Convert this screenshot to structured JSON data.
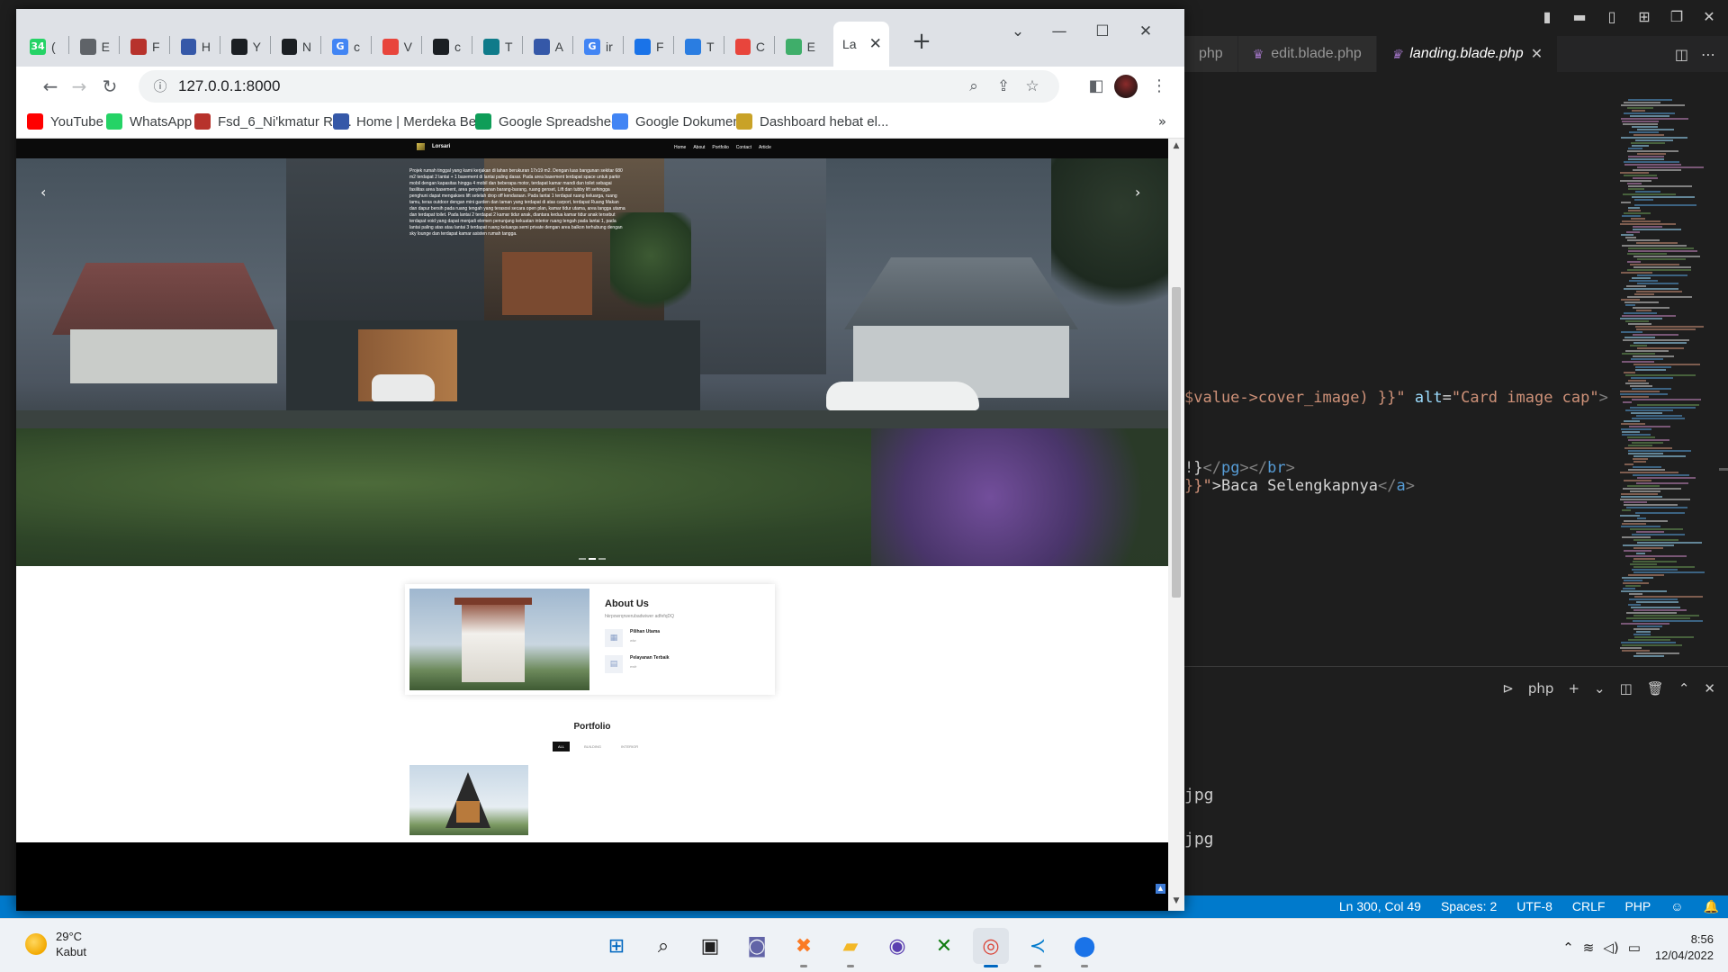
{
  "vscode": {
    "tabs": [
      {
        "label": "php",
        "active": false
      },
      {
        "label": "edit.blade.php",
        "active": false
      },
      {
        "label": "landing.blade.php",
        "active": true
      }
    ],
    "code_lines": [
      {
        "segments": [
          {
            "t": "$value->cover_image) }}\"",
            "c": "str"
          },
          {
            "t": " alt",
            "c": "attr"
          },
          {
            "t": "=",
            "c": "plain"
          },
          {
            "t": "\"Card image cap\"",
            "c": "str"
          },
          {
            "t": ">",
            "c": "punct"
          }
        ]
      },
      {
        "segments": [
          {
            "t": "!}",
            "c": "plain"
          },
          {
            "t": "</",
            "c": "punct"
          },
          {
            "t": "pg",
            "c": "tag"
          },
          {
            "t": "></",
            "c": "punct"
          },
          {
            "t": "br",
            "c": "tag"
          },
          {
            "t": ">",
            "c": "punct"
          }
        ]
      },
      {
        "segments": [
          {
            "t": "}}\"",
            "c": "str"
          },
          {
            "t": ">Baca Selengkapnya",
            "c": "plain"
          },
          {
            "t": "</",
            "c": "punct"
          },
          {
            "t": "a",
            "c": "tag"
          },
          {
            "t": ">",
            "c": "punct"
          }
        ]
      }
    ],
    "panel": {
      "terminal_label": "php",
      "lines": [
        "jpg",
        "jpg"
      ]
    },
    "status": {
      "position": "Ln 300, Col 49",
      "spaces": "Spaces: 2",
      "encoding": "UTF-8",
      "eol": "CRLF",
      "language": "PHP"
    }
  },
  "chrome": {
    "tabs": [
      {
        "icon": "whatsapp-icon",
        "letter": "(",
        "color": "#25d366",
        "text": "34"
      },
      {
        "icon": "globe-icon",
        "letter": "E",
        "color": "#5f6368",
        "text": ""
      },
      {
        "icon": "trello-icon",
        "letter": "F",
        "color": "#b7322c",
        "text": ""
      },
      {
        "icon": "merdeka-icon",
        "letter": "H",
        "color": "#3558a8",
        "text": ""
      },
      {
        "icon": "github-icon",
        "letter": "Y",
        "color": "#1b1f23",
        "text": ""
      },
      {
        "icon": "github-icon",
        "letter": "N",
        "color": "#1b1f23",
        "text": ""
      },
      {
        "icon": "google-icon",
        "letter": "c",
        "color": "#4285f4",
        "text": "G"
      },
      {
        "icon": "fire-icon",
        "letter": "V",
        "color": "#e8453c",
        "text": ""
      },
      {
        "icon": "github-icon",
        "letter": "c",
        "color": "#1b1f23",
        "text": ""
      },
      {
        "icon": "t-icon",
        "letter": "T",
        "color": "#0f7b8a",
        "text": ""
      },
      {
        "icon": "merdeka-icon",
        "letter": "A",
        "color": "#3558a8",
        "text": ""
      },
      {
        "icon": "google-icon",
        "letter": "ir",
        "color": "#4285f4",
        "text": "G"
      },
      {
        "icon": "chart-icon",
        "letter": "F",
        "color": "#1a73e8",
        "text": ""
      },
      {
        "icon": "w3-icon",
        "letter": "T",
        "color": "#2a7de1",
        "text": ""
      },
      {
        "icon": "fire-icon",
        "letter": "C",
        "color": "#e8453c",
        "text": ""
      },
      {
        "icon": "laravel-icon",
        "letter": "E",
        "color": "#3fae6a",
        "text": ""
      }
    ],
    "active_tab_letter": "La",
    "url": "127.0.0.1:8000",
    "bookmarks": [
      {
        "label": "YouTube",
        "icon": "youtube-icon",
        "color": "#ff0000"
      },
      {
        "label": "WhatsApp",
        "icon": "whatsapp-icon",
        "color": "#25d366"
      },
      {
        "label": "Fsd_6_Ni'kmatur Ro...",
        "icon": "trello-icon",
        "color": "#b7322c"
      },
      {
        "label": "Home | Merdeka Be...",
        "icon": "merdeka-icon",
        "color": "#3558a8"
      },
      {
        "label": "Google Spreadsheet",
        "icon": "sheets-icon",
        "color": "#0f9d58"
      },
      {
        "label": "Google Dokumen",
        "icon": "docs-icon",
        "color": "#4285f4"
      },
      {
        "label": "Dashboard hebat el...",
        "icon": "dashboard-icon",
        "color": "#c9a227"
      }
    ],
    "bookmarks_more": "»"
  },
  "site": {
    "brand": "Lorsari",
    "menu": [
      "Home",
      "About",
      "Portfolio",
      "Contact",
      "Article"
    ],
    "hero_text": "Projek rumah tinggal yang kami kerjakan di lahan berukuran 17x19 m2. Dengan luas bangunan sekitar 680 m2 terdapat 2 lantai + 1 basement di lantai paling dasar. Pada area basement terdapat space untuk parkir mobil dengan kapasitas hingga 4 mobil dan beberapa motor, terdapat kamar mandi dan toilet sebagai fasilitas area basement, area penyimpanan barang-barang, ruang genset, Lift dan tubby lift sehingga penghuni dapat mengakses lift setelah drop off kendaraan. Pada lantai 1 terdapat ruang keluarga, ruang tamu, teras outdoor dengan mini garden dan taman yang terdapat di atas carport, terdapat Ruang Makan dan dapur bersih pada ruang tengah yang terasosi secara open plan, kamar tidur utama, area tangga utama dan terdapat toilet. Pada lantai 2 terdapat 2 kamar tidur anak, diantara kedua kamar tidur anak tersebut terdapat void yang dapat menjadi elemen penunjang kekuatan interior ruang tengah pada lantai 1, pada lantai paling atas atau lantai 3 terdapat ruang keluarga semi private dengan area balkon terhubung dengan sky lounge dan terdapat kamar asisten rumah tangga.",
    "about": {
      "title": "About Us",
      "subtitle": "hkrpowrqrwerubadwiwer adfefqDQ",
      "features": [
        {
          "title": "Pilihan Utama",
          "desc": "wlw"
        },
        {
          "title": "Pelayanan Terbaik",
          "desc": "ewfr"
        }
      ]
    },
    "portfolio": {
      "title": "Portfolio",
      "filters": [
        {
          "label": "ALL",
          "active": true
        },
        {
          "label": "BUILDING",
          "active": false
        },
        {
          "label": "INTERIOR",
          "active": false
        }
      ]
    }
  },
  "taskbar": {
    "weather": {
      "temp": "29°C",
      "condition": "Kabut"
    },
    "apps": [
      {
        "icon": "windows-start-icon",
        "running": false,
        "active": false
      },
      {
        "icon": "search-icon",
        "running": false,
        "active": false
      },
      {
        "icon": "task-view-icon",
        "running": false,
        "active": false
      },
      {
        "icon": "teams-chat-icon",
        "running": false,
        "active": false
      },
      {
        "icon": "xampp-icon",
        "running": true,
        "active": false
      },
      {
        "icon": "file-explorer-icon",
        "running": true,
        "active": false
      },
      {
        "icon": "obs-icon",
        "running": false,
        "active": false
      },
      {
        "icon": "xbox-icon",
        "running": false,
        "active": false
      },
      {
        "icon": "chrome-icon",
        "running": true,
        "active": true
      },
      {
        "icon": "vscode-icon",
        "running": true,
        "active": false
      },
      {
        "icon": "maps-pin-icon",
        "running": true,
        "active": false
      }
    ],
    "time": "8:56",
    "date": "12/04/2022"
  }
}
